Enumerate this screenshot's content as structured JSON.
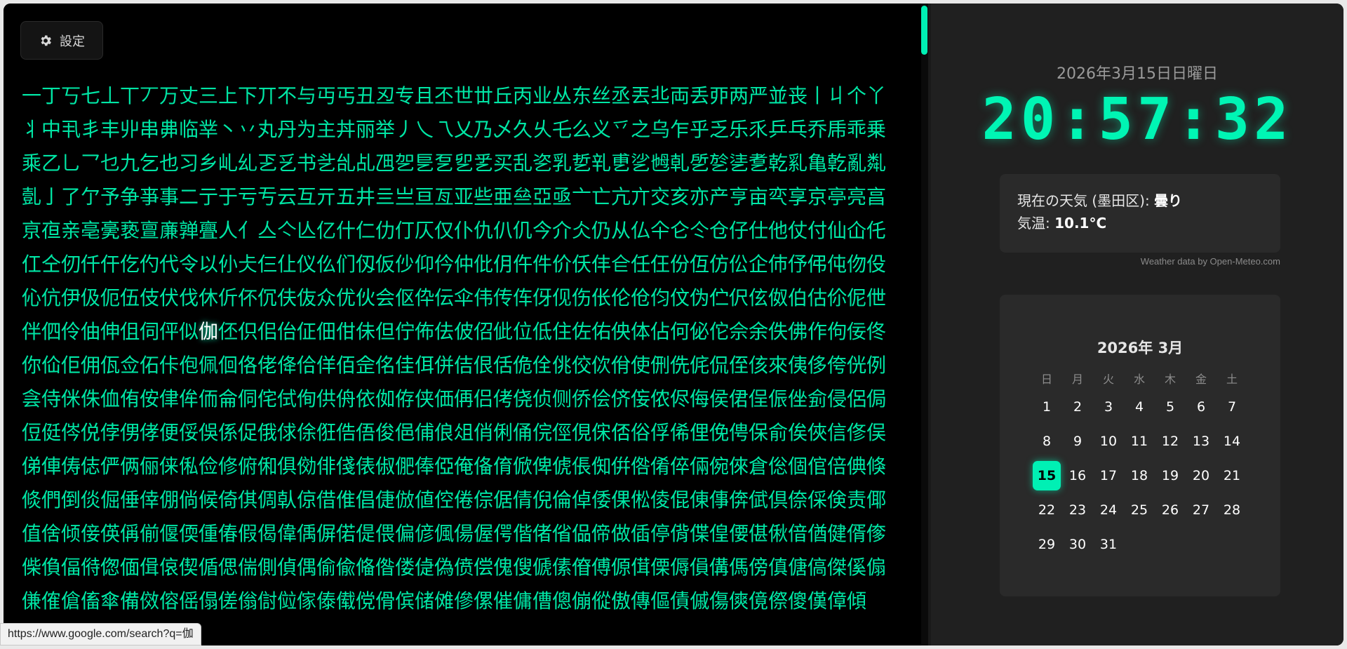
{
  "settings": {
    "label": "設定",
    "icon": "gear-icon"
  },
  "kanji_wall": {
    "before_highlight": "一丁丂七丄丅丆万丈三上下丌不与丏丐丑丒专且丕世丗丘丙业丛东丝丞丟丠両丢丣两严並丧丨丩个丫丬中丮丯丰丱串丳临丵丶丷丸丹为主丼丽举丿乀乁乂乃乄久乆乇么义乊之乌乍乎乏乐乑乒乓乔乕乖乗乘乙乚乛乜九乞也习乡乢乣乤乥书乧乨乩乪乫乬乭乮乯买乱乲乳乴乵乶乷乸乹乺乻乼乽乾乿亀亁亂亃亄亅了亇予争亊事二亍于亏亐云互亓五井亖亗亘亙亚些亜亝亞亟亠亡亢亣交亥亦产亨亩亪享京亭亮亯亰亱亲亳亴亵亶亷亸亹人亻亼亽亾亿什仁仂仃仄仅仆仇仈仉今介仌仍从仏仐仑仒仓仔仕他仗付仙仚仛仜仝仞仟仠仡仢代令以仦仧仨仩仪仫们仭仮仯仰仱仲仳仴仵件价仸仹仺任仼份仾仿伀企伂伃伄伅伆伇伈伉伊伋伌伍伎伏伐休伒伓伔伕伖众优伙会伛伜伝伞伟传伡伢伣伤伥伦伧伨伩伪伫伬伭伮伯估伱伲伳伴伵伶伷伸伹伺伻似",
    "highlight": "伽",
    "after_highlight": "伾伿佀佁佂佃佄佅但佇佈佉佊佋佌位低住佐佑佒体佔何佖佗佘余佚佛作佝佞佟你佡佢佣佤佥佦佧佨佩佪佫佬佭佮佯佰佱佲佳佴併佶佷佸佹佺佻佼佽佾使侀侁侂侃侄侅來侇侈侉侊例侌侍侎侏侐侑侒侓侔侕侖侗侘侙侚供侜依侞侟侠価侢侣侤侥侦侧侨侩侪侫侬侭侮侯侰侱侲侳侴侵侶侷侸侹侺侻侼侽侾便俀俁係促俄俅俆俇俈俉俊俋俌俍俎俏俐俑俒俓俔俕俖俗俘俙俚俛俜保俞俟俠信俢俣俤俥俦俧俨俩俪俫俬俭修俯俰俱俲俳俴俵俶俷俸俹俺俻俼俽俾俿倀倁倂倃倄倅倆倇倈倉倊個倌倍倎倏倐們倒倓倔倕倖倗倘候倚倛倜倝倞借倠倡倢倣値倥倦倧倨倩倪倫倬倭倮倯倰倱倲倳倴倵倶倷倸倹责倻值倽倾倿偀偁偂偃偄偅偆假偈偉偊偋偌偍偎偏偐偑偒偓偔偕偖偗偘偙做偛停偝偞偟偠偡偢偣偤健偦偧偨偩偪偫偬偭偮偯偰偱偲偳側偵偶偷偸偹偺偻偼偽偾偿傀傁傂傃傄傅傆傇傈傉傊傋傌傍傎傏傐傑傒傓傔傕傖傗傘備傚傛傜傝傞傟傠傡傢傣傤傥傦傧储傩傪傫催傭傮傯傰傱傲傳傴債傶傷傸傹傺傻傼傽傾"
  },
  "right_panel": {
    "date": "2026年3月15日日曜日",
    "time": "20:57:32",
    "weather": {
      "location_label": "現在の天気 (墨田区):",
      "condition": "曇り",
      "temp_label": "気温:",
      "temp_value": "10.1°C"
    },
    "credit": "Weather data by Open-Meteo.com",
    "calendar": {
      "title": "2026年 3月",
      "weekdays": [
        "日",
        "月",
        "火",
        "水",
        "木",
        "金",
        "土"
      ],
      "weeks": [
        [
          "1",
          "2",
          "3",
          "4",
          "5",
          "6",
          "7"
        ],
        [
          "8",
          "9",
          "10",
          "11",
          "12",
          "13",
          "14"
        ],
        [
          "15",
          "16",
          "17",
          "18",
          "19",
          "20",
          "21"
        ],
        [
          "22",
          "23",
          "24",
          "25",
          "26",
          "27",
          "28"
        ],
        [
          "29",
          "30",
          "31",
          "",
          "",
          "",
          ""
        ]
      ],
      "today": "15"
    }
  },
  "status_bar": {
    "url": "https://www.google.com/search?q=伽"
  },
  "colors": {
    "accent": "#00f0b4",
    "kanji": "#00e6a5",
    "panel": "#202020"
  }
}
